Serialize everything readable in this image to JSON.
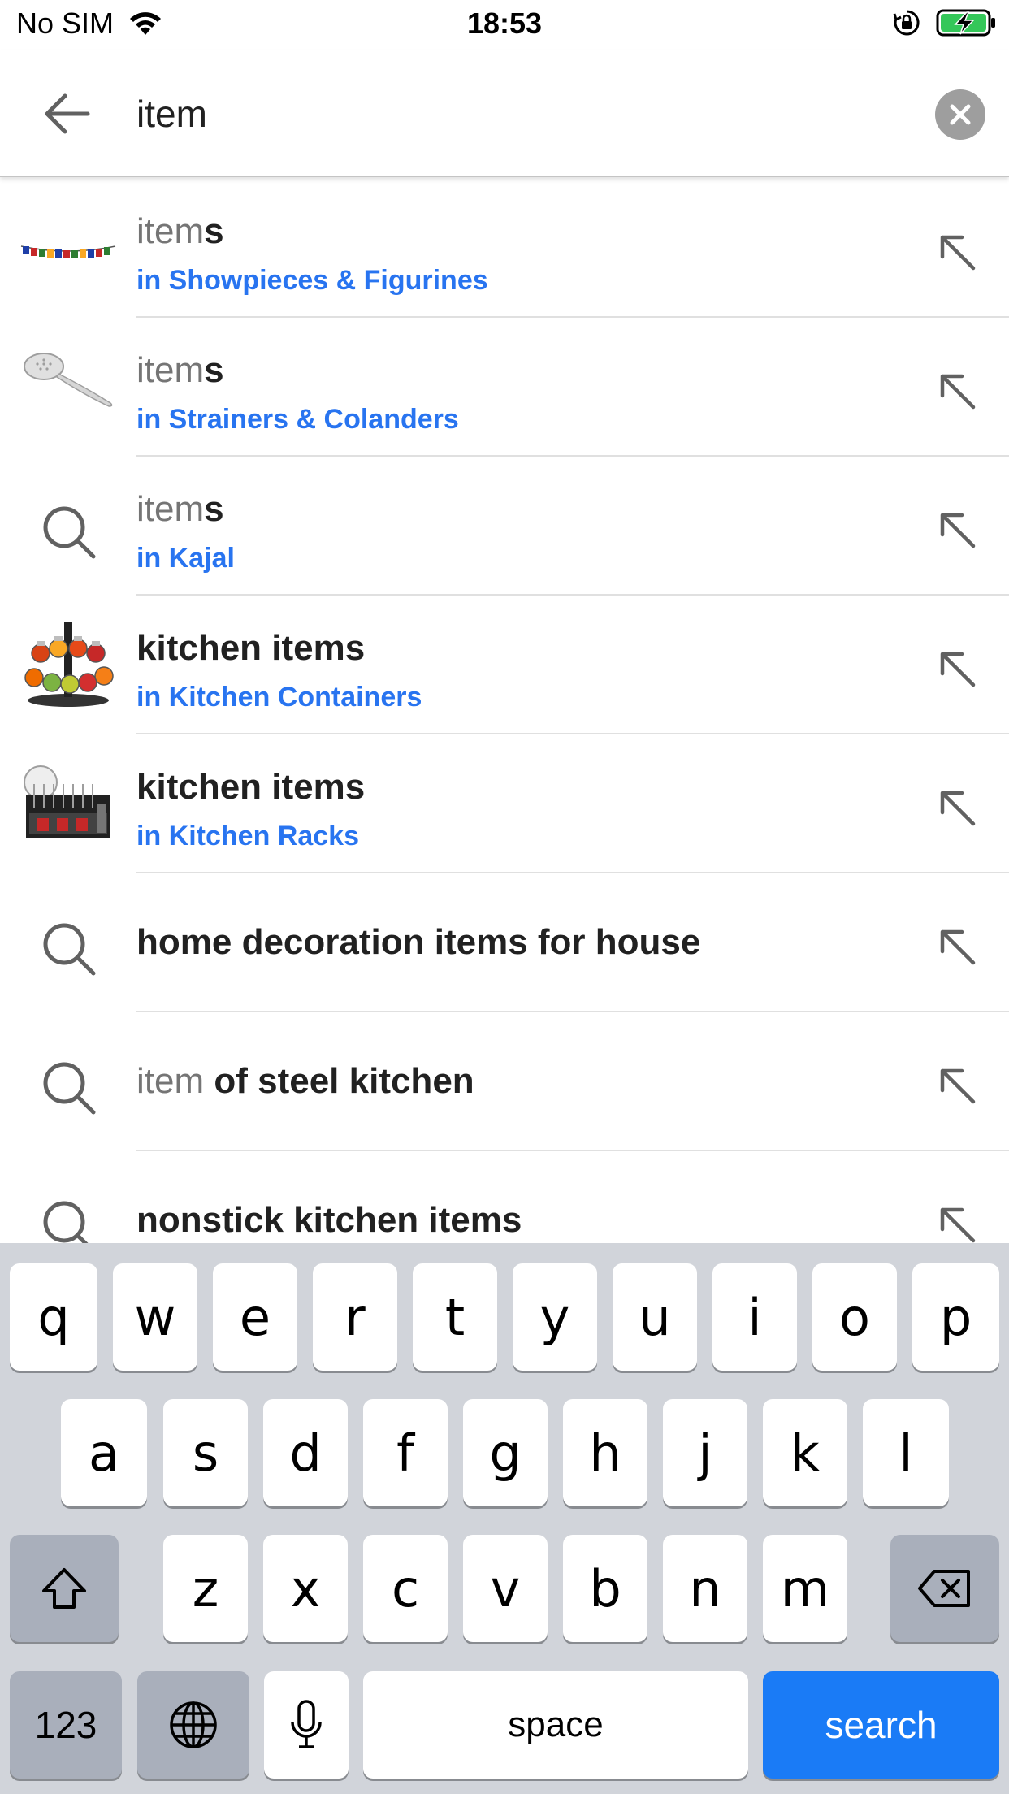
{
  "status_bar": {
    "carrier": "No SIM",
    "time": "18:53"
  },
  "search": {
    "query": "item"
  },
  "suggestions": [
    {
      "typed": "item",
      "rest": "s",
      "category": "in Showpieces & Figurines",
      "thumb": "prayer-flags-thumbnail"
    },
    {
      "typed": "item",
      "rest": "s",
      "category": "in Strainers & Colanders",
      "thumb": "strainer-spoon-thumbnail"
    },
    {
      "typed": "item",
      "rest": "s",
      "category": "in Kajal",
      "thumb": "search-icon"
    },
    {
      "full": "kitchen items",
      "category": "in Kitchen Containers",
      "thumb": "spice-rack-thumbnail"
    },
    {
      "full": "kitchen items",
      "category": "in Kitchen Racks",
      "thumb": "dish-rack-thumbnail"
    },
    {
      "full": "home decoration items for house",
      "thumb": "search-icon"
    },
    {
      "typed": "item",
      "rest": " of steel kitchen",
      "thumb": "search-icon"
    },
    {
      "full": "nonstick kitchen items",
      "thumb": "search-icon"
    }
  ],
  "keyboard": {
    "row1": [
      "q",
      "w",
      "e",
      "r",
      "t",
      "y",
      "u",
      "i",
      "o",
      "p"
    ],
    "row2": [
      "a",
      "s",
      "d",
      "f",
      "g",
      "h",
      "j",
      "k",
      "l"
    ],
    "row3": [
      "z",
      "x",
      "c",
      "v",
      "b",
      "n",
      "m"
    ],
    "numbers_label": "123",
    "space_label": "space",
    "search_label": "search"
  },
  "colors": {
    "accent": "#2874f0",
    "search_key": "#1a7bf6",
    "keyboard_bg": "#d1d4da",
    "battery": "#34c759"
  }
}
